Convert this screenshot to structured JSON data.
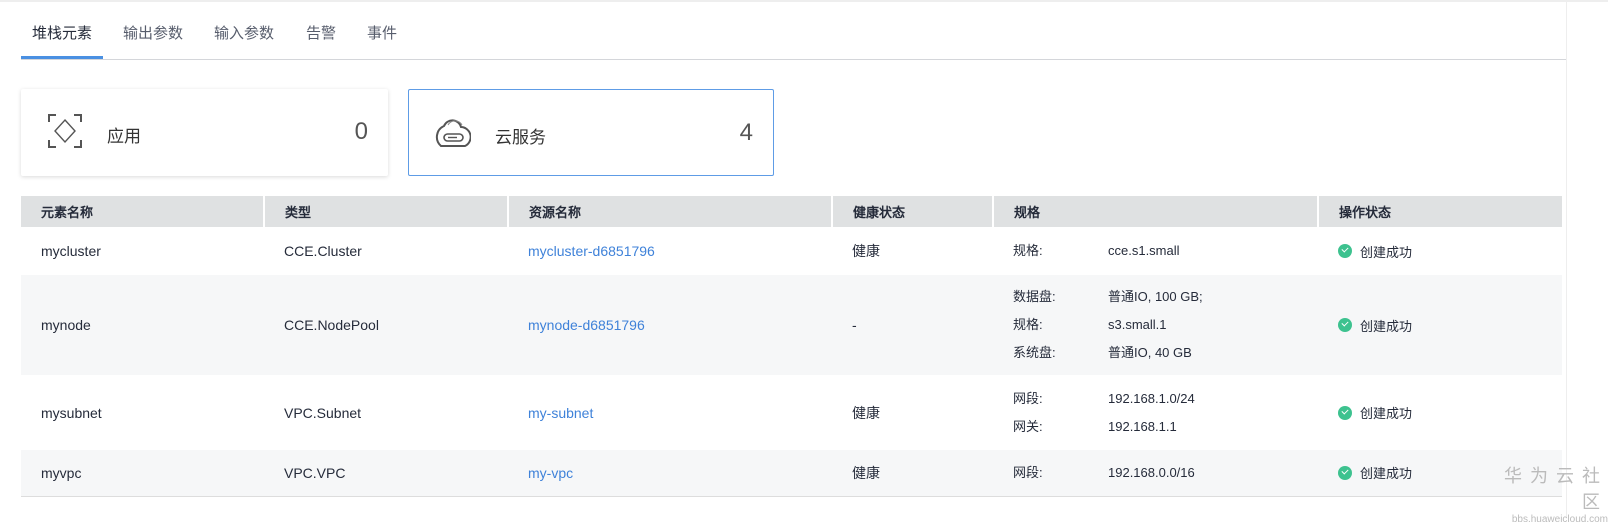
{
  "tabs": [
    "堆栈元素",
    "输出参数",
    "输入参数",
    "告警",
    "事件"
  ],
  "cards": [
    {
      "label": "应用",
      "count": "0"
    },
    {
      "label": "云服务",
      "count": "4"
    }
  ],
  "table": {
    "headers": [
      "元素名称",
      "类型",
      "资源名称",
      "健康状态",
      "规格",
      "操作状态"
    ],
    "rows": [
      {
        "name": "mycluster",
        "type": "CCE.Cluster",
        "resource": "mycluster-d6851796",
        "health": "健康",
        "specs": [
          {
            "k": "规格:",
            "v": "cce.s1.small"
          }
        ],
        "status": "创建成功"
      },
      {
        "name": "mynode",
        "type": "CCE.NodePool",
        "resource": "mynode-d6851796",
        "health": "-",
        "specs": [
          {
            "k": "数据盘:",
            "v": "普通IO, 100 GB;"
          },
          {
            "k": "规格:",
            "v": "s3.small.1"
          },
          {
            "k": "系统盘:",
            "v": "普通IO, 40 GB"
          }
        ],
        "status": "创建成功"
      },
      {
        "name": "mysubnet",
        "type": "VPC.Subnet",
        "resource": "my-subnet",
        "health": "健康",
        "specs": [
          {
            "k": "网段:",
            "v": "192.168.1.0/24"
          },
          {
            "k": "网关:",
            "v": "192.168.1.1"
          }
        ],
        "status": "创建成功"
      },
      {
        "name": "myvpc",
        "type": "VPC.VPC",
        "resource": "my-vpc",
        "health": "健康",
        "specs": [
          {
            "k": "网段:",
            "v": "192.168.0.0/16"
          }
        ],
        "status": "创建成功"
      }
    ]
  },
  "watermark": {
    "title": "华为云社区",
    "url": "bbs.huaweicloud.com"
  },
  "colors": {
    "accent": "#4a90e2",
    "success": "#3dc28f",
    "link": "#3f82d9"
  }
}
